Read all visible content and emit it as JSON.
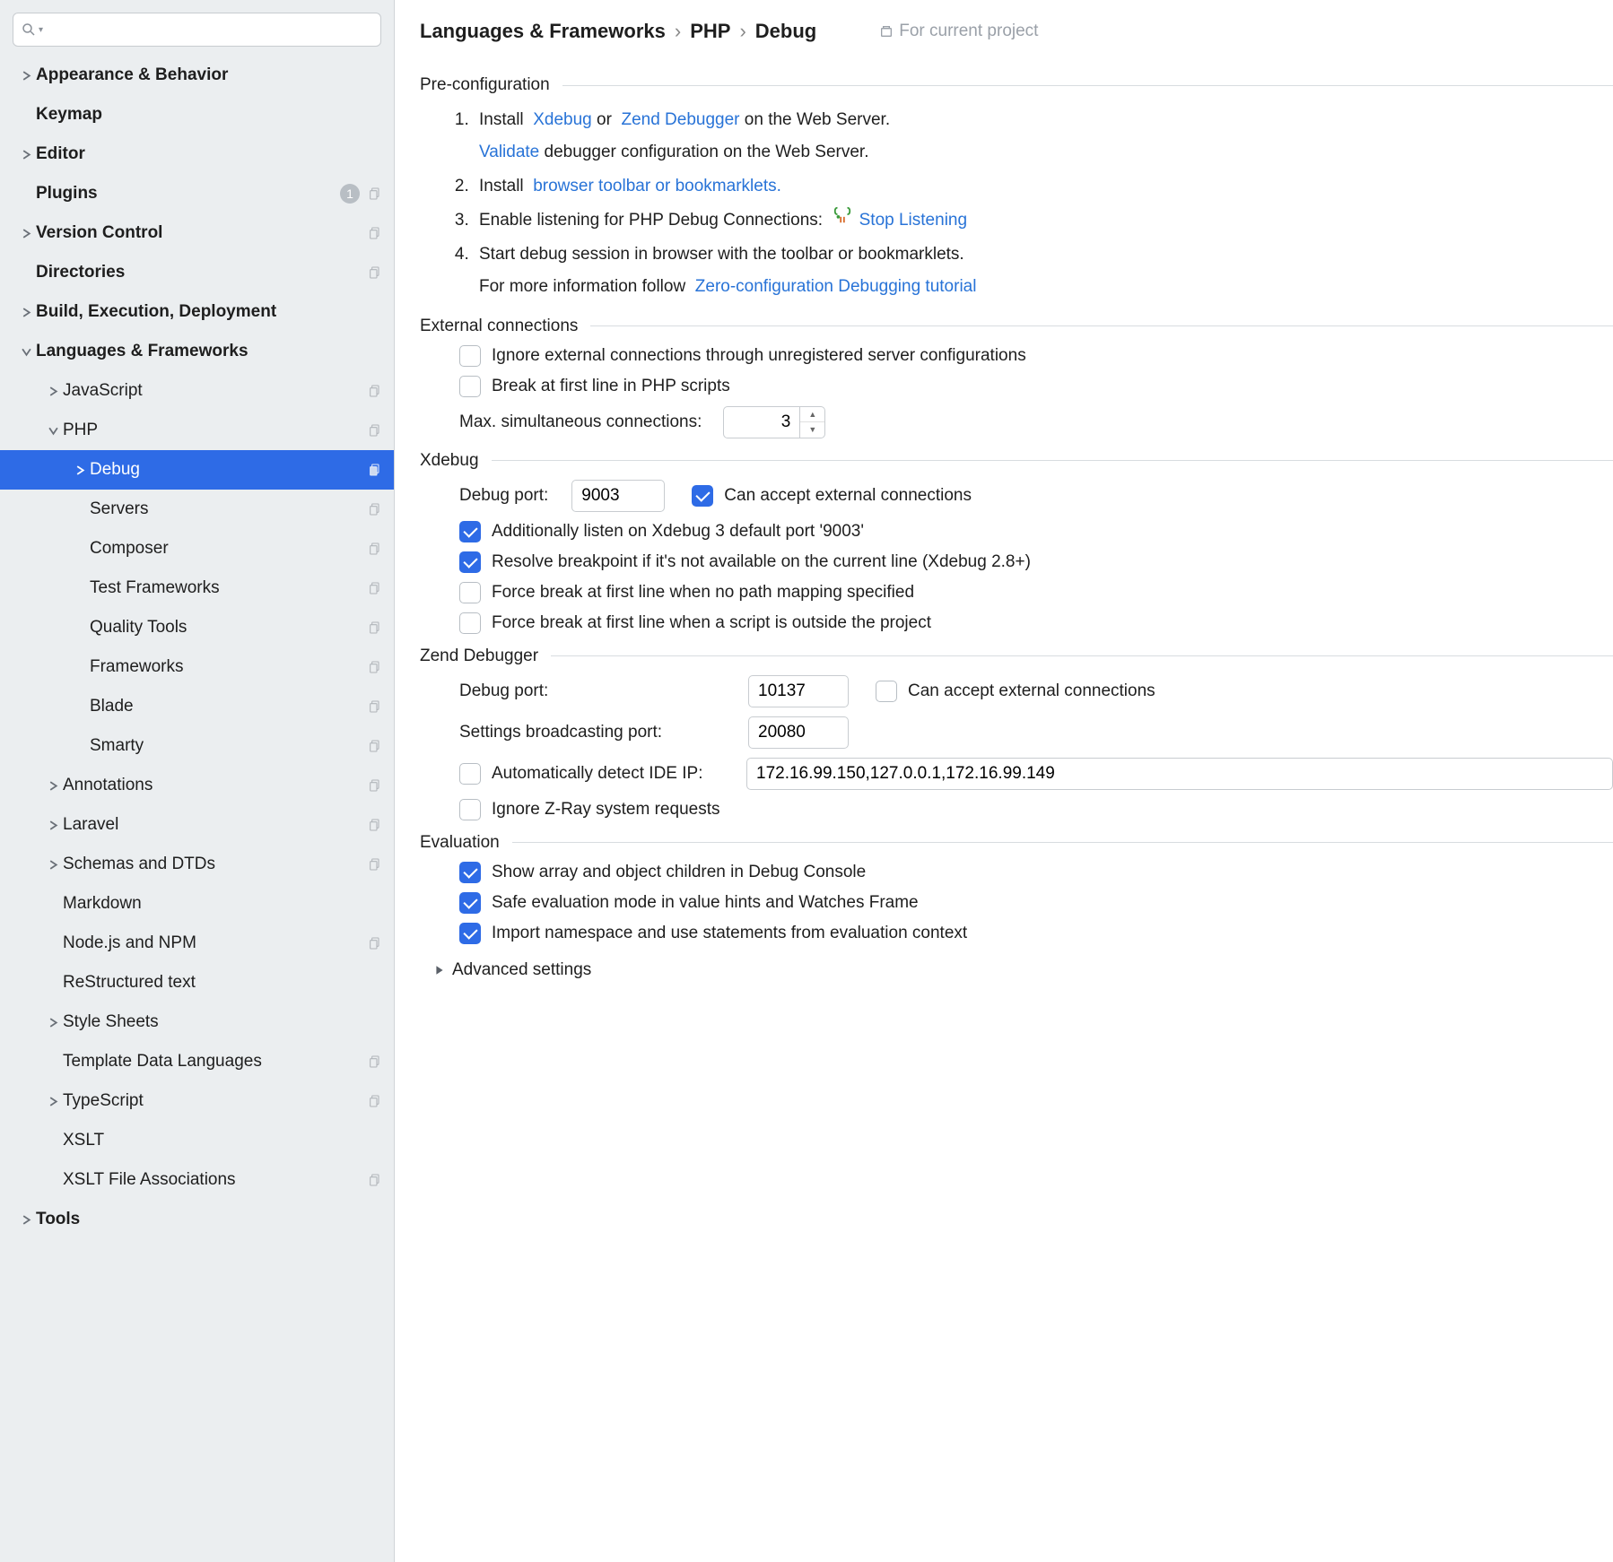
{
  "search": {
    "placeholder": ""
  },
  "sidebar": {
    "items": [
      {
        "label": "Appearance & Behavior",
        "depth": 0,
        "arrow": "right",
        "bold": true
      },
      {
        "label": "Keymap",
        "depth": 0,
        "arrow": "none",
        "bold": true
      },
      {
        "label": "Editor",
        "depth": 0,
        "arrow": "right",
        "bold": true
      },
      {
        "label": "Plugins",
        "depth": 0,
        "arrow": "none",
        "bold": true,
        "badge": "1",
        "copy": true
      },
      {
        "label": "Version Control",
        "depth": 0,
        "arrow": "right",
        "bold": true,
        "copy": true
      },
      {
        "label": "Directories",
        "depth": 0,
        "arrow": "none",
        "bold": true,
        "copy": true
      },
      {
        "label": "Build, Execution, Deployment",
        "depth": 0,
        "arrow": "right",
        "bold": true
      },
      {
        "label": "Languages & Frameworks",
        "depth": 0,
        "arrow": "down",
        "bold": true
      },
      {
        "label": "JavaScript",
        "depth": 1,
        "arrow": "right",
        "copy": true
      },
      {
        "label": "PHP",
        "depth": 1,
        "arrow": "down",
        "copy": true
      },
      {
        "label": "Debug",
        "depth": 2,
        "arrow": "right",
        "copy": true,
        "selected": true
      },
      {
        "label": "Servers",
        "depth": 2,
        "arrow": "none",
        "copy": true
      },
      {
        "label": "Composer",
        "depth": 2,
        "arrow": "none",
        "copy": true
      },
      {
        "label": "Test Frameworks",
        "depth": 2,
        "arrow": "none",
        "copy": true
      },
      {
        "label": "Quality Tools",
        "depth": 2,
        "arrow": "none",
        "copy": true
      },
      {
        "label": "Frameworks",
        "depth": 2,
        "arrow": "none",
        "copy": true
      },
      {
        "label": "Blade",
        "depth": 2,
        "arrow": "none",
        "copy": true
      },
      {
        "label": "Smarty",
        "depth": 2,
        "arrow": "none",
        "copy": true
      },
      {
        "label": "Annotations",
        "depth": 1,
        "arrow": "right",
        "copy": true
      },
      {
        "label": "Laravel",
        "depth": 1,
        "arrow": "right",
        "copy": true
      },
      {
        "label": "Schemas and DTDs",
        "depth": 1,
        "arrow": "right",
        "copy": true
      },
      {
        "label": "Markdown",
        "depth": 1,
        "arrow": "none"
      },
      {
        "label": "Node.js and NPM",
        "depth": 1,
        "arrow": "none",
        "copy": true
      },
      {
        "label": "ReStructured text",
        "depth": 1,
        "arrow": "none"
      },
      {
        "label": "Style Sheets",
        "depth": 1,
        "arrow": "right"
      },
      {
        "label": "Template Data Languages",
        "depth": 1,
        "arrow": "none",
        "copy": true
      },
      {
        "label": "TypeScript",
        "depth": 1,
        "arrow": "right",
        "copy": true
      },
      {
        "label": "XSLT",
        "depth": 1,
        "arrow": "none"
      },
      {
        "label": "XSLT File Associations",
        "depth": 1,
        "arrow": "none",
        "copy": true
      },
      {
        "label": "Tools",
        "depth": 0,
        "arrow": "right",
        "bold": true
      }
    ]
  },
  "breadcrumb": [
    "Languages & Frameworks",
    "PHP",
    "Debug"
  ],
  "project_scope": "For current project",
  "sections": {
    "preconf": {
      "title": "Pre-configuration",
      "step1_install": "Install",
      "step1_xdebug": "Xdebug",
      "step1_or": "or",
      "step1_zend": "Zend Debugger",
      "step1_tail": "on the Web Server.",
      "step1_validate": "Validate",
      "step1_validate_tail": "debugger configuration on the Web Server.",
      "step2_install": "Install",
      "step2_link": "browser toolbar or bookmarklets.",
      "step3_text": "Enable listening for PHP Debug Connections:",
      "step3_stop": "Stop Listening",
      "step4_text": "Start debug session in browser with the toolbar or bookmarklets.",
      "step4_more": "For more information follow",
      "step4_link": "Zero-configuration Debugging tutorial"
    },
    "ext": {
      "title": "External connections",
      "ignore": "Ignore external connections through unregistered server configurations",
      "break_first": "Break at first line in PHP scripts",
      "max_conn_label": "Max. simultaneous connections:",
      "max_conn_value": "3"
    },
    "xdebug": {
      "title": "Xdebug",
      "port_label": "Debug port:",
      "port_value": "9003",
      "accept_ext": "Can accept external connections",
      "listen_default": "Additionally listen on Xdebug 3 default port '9003'",
      "resolve_bp": "Resolve breakpoint if it's not available on the current line (Xdebug 2.8+)",
      "force_nopath": "Force break at first line when no path mapping specified",
      "force_outside": "Force break at first line when a script is outside the project"
    },
    "zend": {
      "title": "Zend Debugger",
      "port_label": "Debug port:",
      "port_value": "10137",
      "accept_ext": "Can accept external connections",
      "broadcast_label": "Settings broadcasting port:",
      "broadcast_value": "20080",
      "auto_ip": "Automatically detect IDE IP:",
      "ip_value": "172.16.99.150,127.0.0.1,172.16.99.149",
      "ignore_zray": "Ignore Z-Ray system requests"
    },
    "eval": {
      "title": "Evaluation",
      "show_children": "Show array and object children in Debug Console",
      "safe_eval": "Safe evaluation mode in value hints and Watches Frame",
      "import_ns": "Import namespace and use statements from evaluation context"
    },
    "advanced": "Advanced settings"
  }
}
